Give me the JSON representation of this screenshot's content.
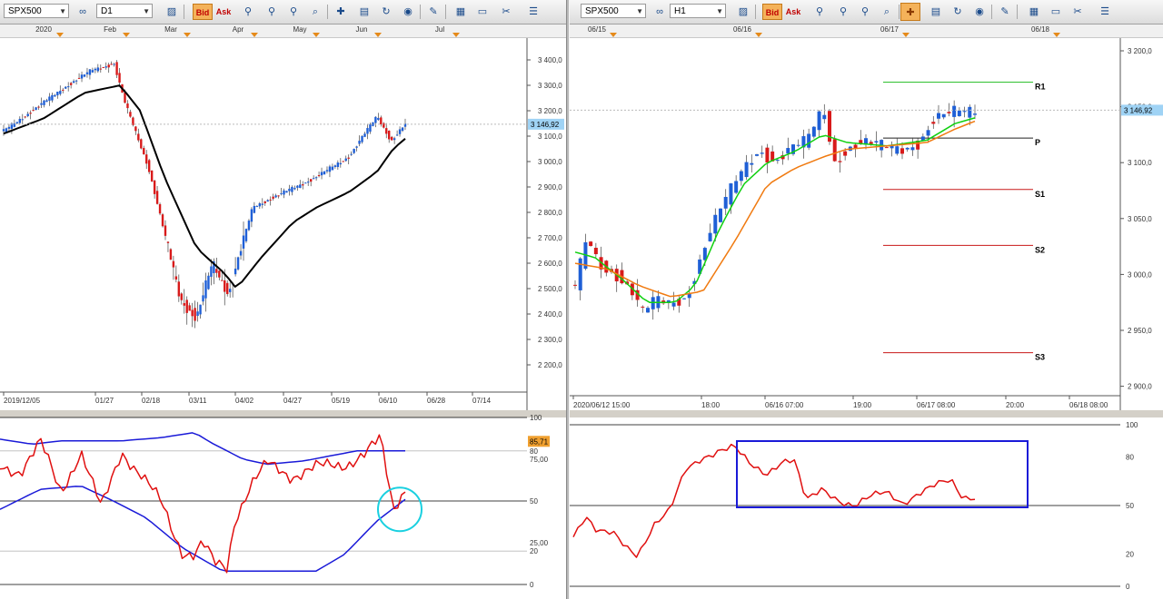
{
  "left": {
    "toolbar": {
      "symbol": "SPX500",
      "period": "D1",
      "bid": "Bid",
      "ask": "Ask"
    },
    "top_ticks": [
      "2020",
      "Feb",
      "Mar",
      "Apr",
      "May",
      "Jun",
      "Jul"
    ],
    "price_labels": [
      "3 400,0",
      "3 300,0",
      "3 200,0",
      "3 100,0",
      "3 000,0",
      "2 900,0",
      "2 800,0",
      "2 700,0",
      "2 600,0",
      "2 500,0",
      "2 400,0",
      "2 300,0",
      "2 200,0"
    ],
    "current_price": "3 146,92",
    "date_labels": [
      "2019/12/05",
      "01/27",
      "02/18",
      "03/11",
      "04/02",
      "04/27",
      "05/19",
      "06/10",
      "06/28",
      "07/14"
    ],
    "indicator_labels": [
      "100",
      "80",
      "75,00",
      "50",
      "25,00",
      "20",
      "0"
    ],
    "indicator_value": "85,71"
  },
  "right": {
    "toolbar": {
      "symbol": "SPX500",
      "period": "H1",
      "bid": "Bid",
      "ask": "Ask"
    },
    "top_ticks": [
      "06/15",
      "06/16",
      "06/17",
      "06/18"
    ],
    "price_labels": [
      "3 200,0",
      "3 150,0",
      "3 100,0",
      "3 050,0",
      "3 000,0",
      "2 950,0",
      "2 900,0"
    ],
    "current_price": "3 146,92",
    "date_labels": [
      "2020/06/12 15:00",
      "18:00",
      "06/16 07:00",
      "19:00",
      "06/17 08:00",
      "20:00",
      "06/18 08:00"
    ],
    "pivots": [
      "R1",
      "P",
      "S1",
      "S2",
      "S3"
    ],
    "indicator_labels": [
      "100",
      "80",
      "50",
      "20",
      "0"
    ]
  },
  "colors": {
    "bull": "#1f5fd6",
    "bear": "#d81a1a",
    "ma_black": "#000000",
    "band_blue": "#1a1ad8",
    "osc_red": "#e01010",
    "ma_green": "#10d010",
    "ma_orange": "#f07a10",
    "pivot_green": "#30c030",
    "pivot_red": "#c81818",
    "highlight_cyan": "#1ad0e0",
    "highlight_box": "#1a1ad8",
    "price_tag": "#9fd3f5",
    "indicator_tag": "#f0a030"
  },
  "icons": [
    "link-icon",
    "chart-type-icon",
    "bid-button",
    "ask-button",
    "crosshair-icon",
    "zoom-icon",
    "indicator-icon",
    "template-icon",
    "refresh-icon",
    "globe-icon",
    "draw-icon",
    "image-icon",
    "window-icon",
    "tools-icon",
    "menu-icon"
  ]
}
